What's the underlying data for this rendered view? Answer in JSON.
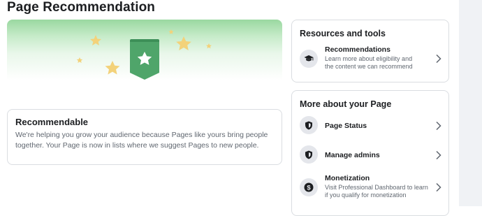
{
  "page": {
    "title": "Page Recommendation"
  },
  "recommendable": {
    "heading": "Recommendable",
    "body": "We're helping you grow your audience because Pages like yours bring people together. Your Page is now in lists where we suggest Pages to new people."
  },
  "resources": {
    "title": "Resources and tools",
    "items": [
      {
        "label": "Recommendations",
        "description": "Learn more about eligibility and the content we can recommend",
        "icon": "graduation-cap-icon"
      }
    ]
  },
  "more": {
    "title": "More about your Page",
    "items": [
      {
        "label": "Page Status",
        "icon": "shield-icon"
      },
      {
        "label": "Manage admins",
        "icon": "shield-icon"
      },
      {
        "label": "Monetization",
        "description": "Visit Professional Dashboard to learn if you qualify for monetization",
        "icon": "dollar-icon"
      }
    ]
  },
  "colors": {
    "badge_green": "#4fa56a",
    "star_yellow": "#f3d27a",
    "banner_green": "#9ad8a0",
    "icon_bg": "#e4e6eb"
  }
}
